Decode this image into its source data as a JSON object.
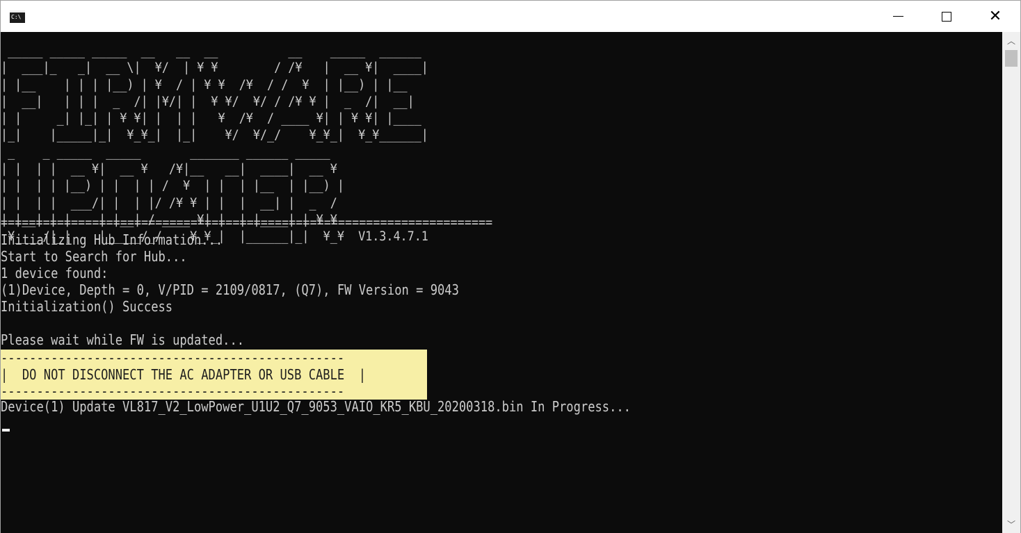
{
  "window": {
    "title": "",
    "icon": "cmd-console-icon",
    "icon_text": "C:\\",
    "controls": {
      "minimize": "minimize-icon",
      "maximize": "maximize-icon",
      "close": "close-icon",
      "close_glyph": "✕"
    }
  },
  "console": {
    "banner_lines": [
      " _____ _____ _____  __   __  __          __    _____  ______ ",
      "|  ___|_   _|  __ \\|  ¥/  | ¥ ¥        / /¥   |  __ ¥|  ____|",
      "| |__    | | | |__) | ¥  / | ¥ ¥  /¥  / /  ¥  | |__) | |__   ",
      "|  __|   | | |  _  /| |¥/| |  ¥ ¥/  ¥/ / /¥ ¥ |  _  /|  __|  ",
      "| |     _| |_| | ¥ ¥| |  | |   ¥  /¥  / ____ ¥| | ¥ ¥| |____ ",
      "|_|    |_____|_|  ¥_¥_|  |_|    ¥/  ¥/_/    ¥_¥_|  ¥_¥______|",
      " _    _ _____  _____       _______ ______ _____  ",
      "| |  | |  __ ¥|  __ ¥   /¥|__   __|  ____|  __ ¥ ",
      "| |  | | |__) | |  | | /  ¥  | |  | |__  | |__) |",
      "| |  | |  ___/| |  | |/ /¥ ¥ | |  |  __| |  _  / ",
      "| |__| | |    | |__| / ____ ¥| |  | |____| | ¥ ¥ ",
      " ¥____/|_|    |_____/_/    ¥_¥_|  |______|_|  ¥_¥  V1.3.4.7.1"
    ],
    "version": "V1.3.4.7.1",
    "separator": "======================================================================",
    "log_lines": [
      "Initializing Hub Information...",
      "Start to Search for Hub...",
      "1 device found:",
      "(1)Device, Depth = 0, V/PID = 2109/0817, (Q7), FW Version = 9043",
      "Initialization() Success",
      "",
      "Please wait while FW is updated..."
    ],
    "warning_lines": [
      "------------------------------------------------",
      "|  DO NOT DISCONNECT THE AC ADAPTER OR USB CABLE  |",
      "------------------------------------------------"
    ],
    "progress_line": "Device(1) Update VL817_V2_LowPower_U1U2_Q7_9053_VAIO_KR5_KBU_20200318.bin In Progress...",
    "warning_bg": "#f7efa6",
    "text_color": "#cccccc",
    "background": "#0c0c0c"
  },
  "scrollbar": {
    "up": "scroll-up-arrow-icon",
    "down": "scroll-down-arrow-icon",
    "up_glyph": "︿",
    "down_glyph": "﹀"
  }
}
